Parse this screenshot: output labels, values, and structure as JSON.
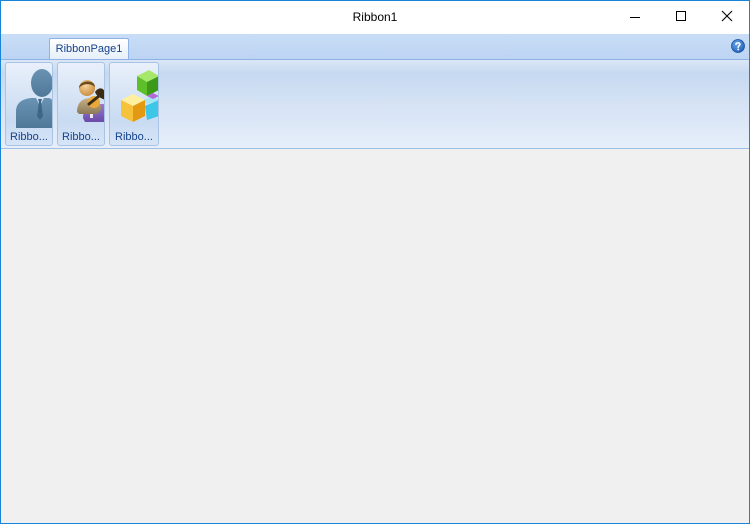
{
  "window": {
    "title": "Ribbon1"
  },
  "caption_buttons": {
    "minimize_icon": "minimize-icon",
    "maximize_icon": "maximize-icon",
    "close_icon": "close-icon"
  },
  "ribbon": {
    "tabs": [
      {
        "label": "RibbonPage1",
        "selected": true
      }
    ],
    "help_icon": "help-icon",
    "groups": [
      {
        "label": "Ribbo...",
        "icon": "person-silhouette-icon"
      },
      {
        "label": "Ribbo...",
        "icon": "user-group-icon"
      },
      {
        "label": "Ribbo...",
        "icon": "cubes-icon"
      }
    ]
  },
  "colors": {
    "window_border": "#1883d7",
    "ribbon_text": "#15428b",
    "client_background": "#f0f0f0"
  }
}
